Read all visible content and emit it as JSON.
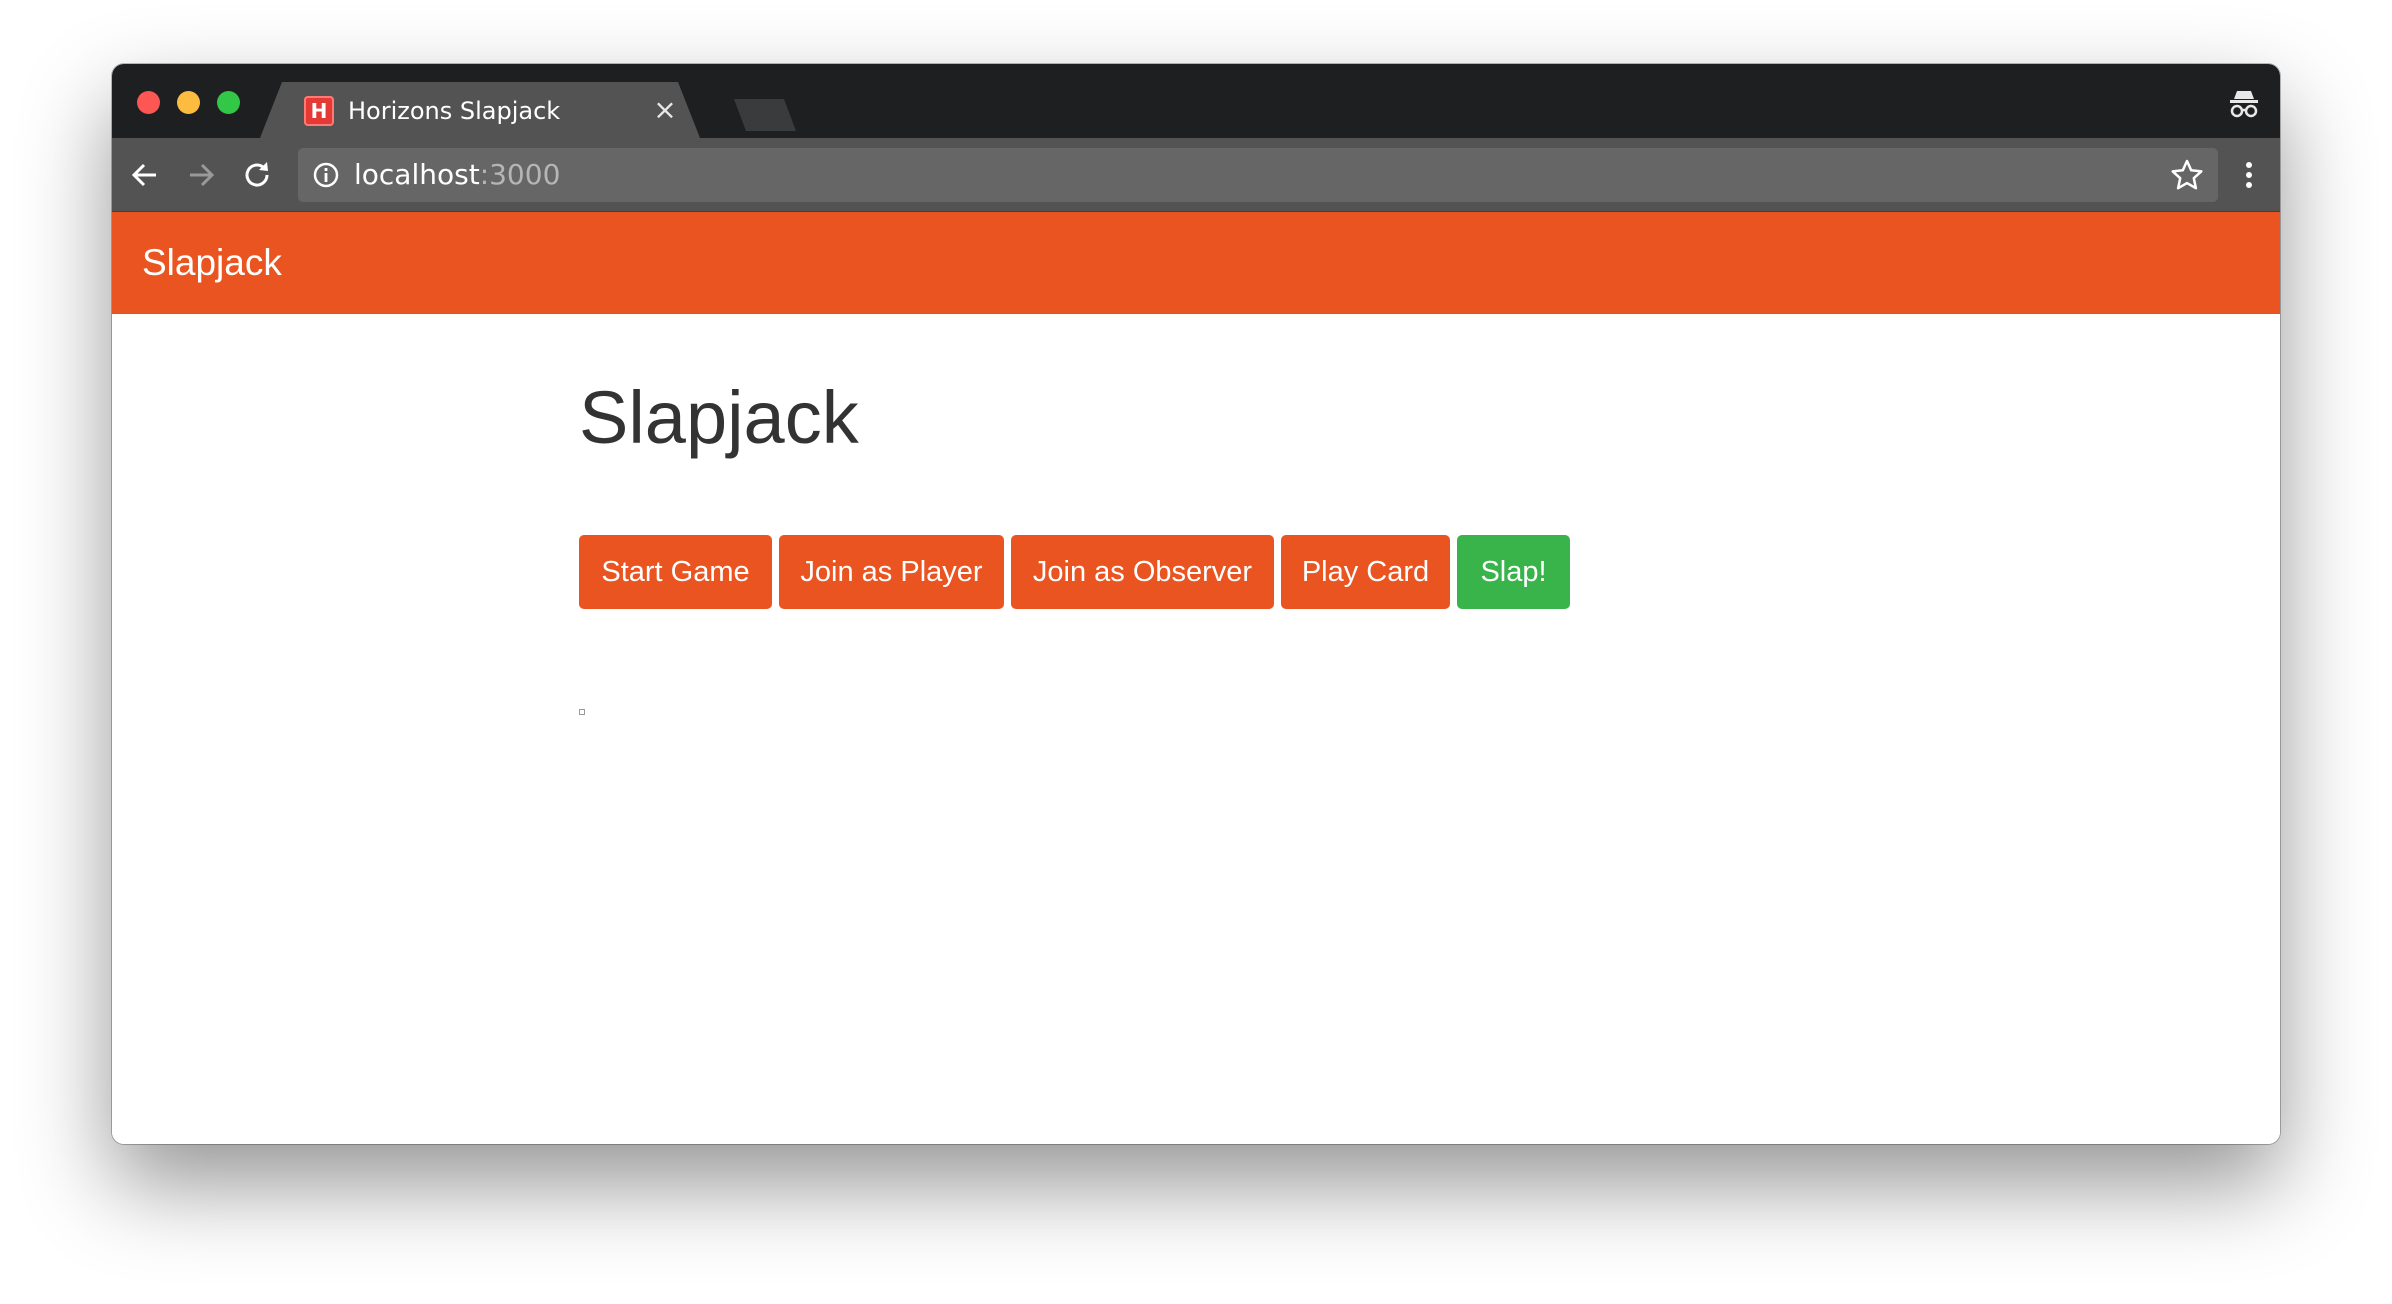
{
  "browser": {
    "tab": {
      "favicon_letter": "H",
      "title": "Horizons Slapjack"
    },
    "address": {
      "host": "localhost",
      "port": ":3000"
    },
    "icons": {
      "back": "back-arrow-icon",
      "forward": "forward-arrow-icon",
      "reload": "reload-icon",
      "info": "info-icon",
      "bookmark": "star-icon",
      "menu": "kebab-menu-icon",
      "incognito": "incognito-icon",
      "tab_close": "close-icon"
    }
  },
  "navbar": {
    "brand": "Slapjack",
    "color": "#e95420"
  },
  "main": {
    "heading": "Slapjack",
    "buttons": [
      {
        "label": "Start Game",
        "color": "#e95420"
      },
      {
        "label": "Join as Player",
        "color": "#e95420"
      },
      {
        "label": "Join as Observer",
        "color": "#e95420"
      },
      {
        "label": "Play Card",
        "color": "#e95420"
      },
      {
        "label": "Slap!",
        "color": "#38b44a"
      }
    ]
  }
}
